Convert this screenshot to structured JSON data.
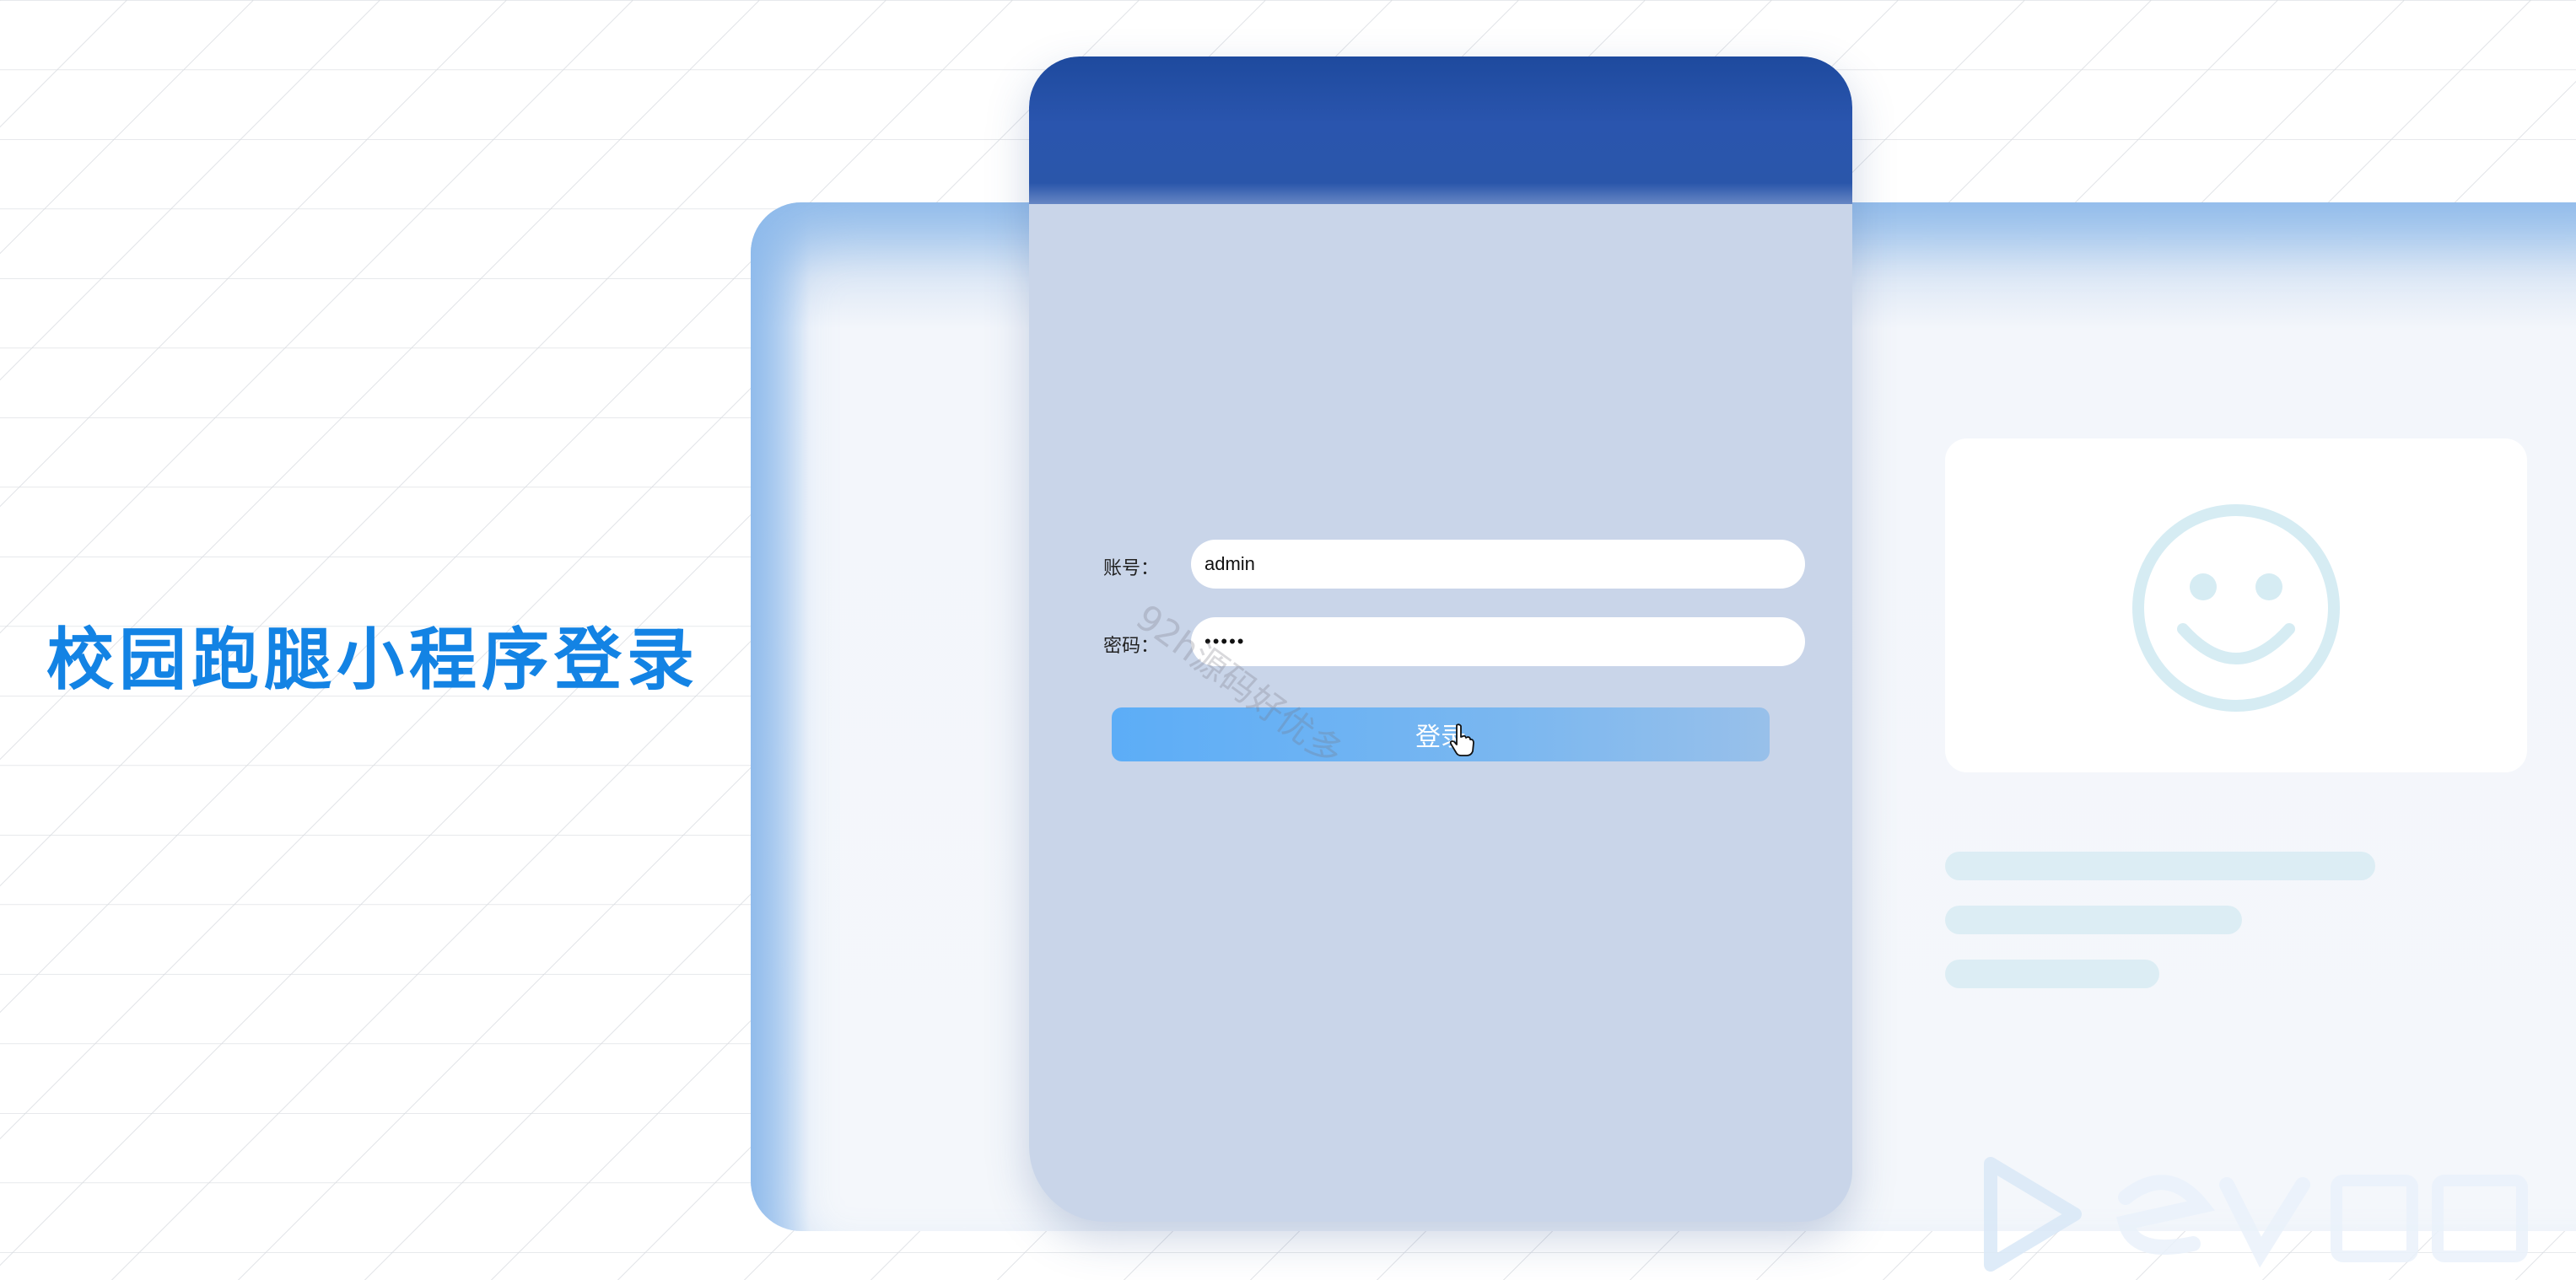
{
  "page_title": "校园跑腿小程序登录",
  "login_form": {
    "account_label": "账号：",
    "account_value": "admin",
    "password_label": "密码：",
    "password_value": "•••••",
    "login_button": "登录"
  },
  "watermark": "92h源码好优多",
  "colors": {
    "title": "#1383e4",
    "card_header": "#2a55ae",
    "card_body": "#c9d5e9",
    "button": "#5cadf7",
    "placeholder_bar": "#dcedf4"
  },
  "icons": [
    "smiley-icon",
    "brand-logo-icon",
    "pointer-cursor-icon"
  ]
}
